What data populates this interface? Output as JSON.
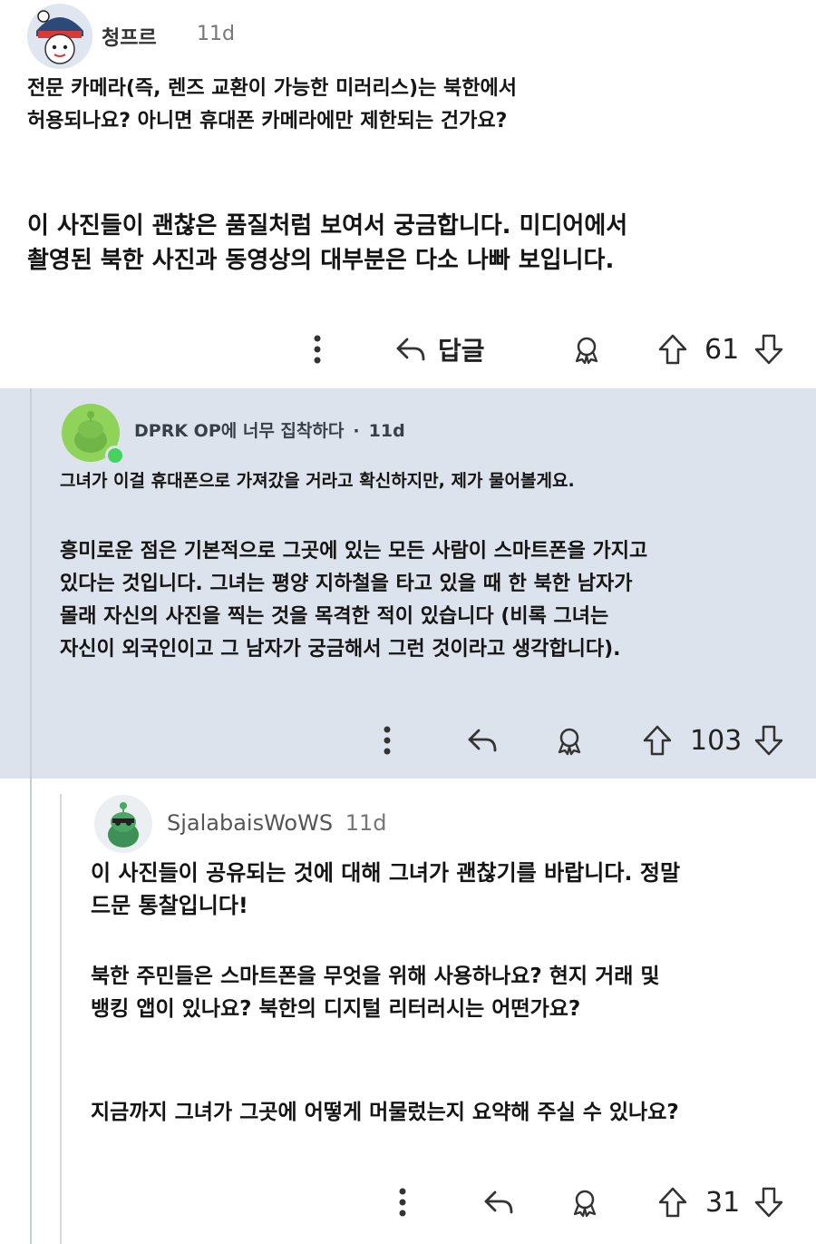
{
  "comment1": {
    "username": "청프르",
    "time": "11d",
    "question_lines": [
      "전문 카메라(즉, 렌즈 교환이 가능한 미러리스)는 북한에서",
      "허용되나요? 아니면 휴대폰 카메라에만 제한되는 건가요?"
    ],
    "followup_lines": [
      "이 사진들이 괜찮은 품질처럼 보여서 궁금합니다. 미디어에서",
      "촬영된 북한 사진과 동영상의 대부분은 다소 나빠 보입니다."
    ],
    "reply_label": "답글",
    "votes": "61"
  },
  "comment2": {
    "username": "DPRK OP에 너무 집착하다",
    "separator": "·",
    "time": "11d",
    "intro": "그녀가 이걸 휴대폰으로 가져갔을 거라고 확신하지만, 제가 물어볼게요.",
    "body_lines": [
      "흥미로운 점은 기본적으로 그곳에 있는 모든 사람이 스마트폰을 가지고",
      "있다는 것입니다. 그녀는 평양 지하철을 타고 있을 때 한 북한 남자가",
      "몰래 자신의 사진을 찍는 것을 목격한 적이 있습니다 (비록 그녀는",
      "자신이 외국인이고 그 남자가 궁금해서 그런 것이라고 생각합니다)."
    ],
    "votes": "103"
  },
  "comment3": {
    "username": "SjalabaisWoWS",
    "time": "11d",
    "para1_lines": [
      "이 사진들이 공유되는 것에 대해 그녀가 괜찮기를 바랍니다. 정말",
      "드문 통찰입니다!"
    ],
    "para2_lines": [
      "북한 주민들은 스마트폰을 무엇을 위해 사용하나요? 현지 거래 및",
      "뱅킹 앱이 있나요? 북한의 디지털 리터러시는 어떤가요?"
    ],
    "para3": "지금까지 그녀가 그곳에 어떻게 머물렀는지 요약해 주실 수 있나요?",
    "votes": "31"
  },
  "icons": {
    "more": "more-vertical-icon",
    "reply": "reply-arrow-icon",
    "award": "award-icon",
    "upvote": "upvote-arrow-icon",
    "downvote": "downvote-arrow-icon"
  },
  "colors": {
    "highlight_bg": "#dde3ec",
    "online_dot": "#46d160",
    "avatar_green": "#8fd35a"
  }
}
